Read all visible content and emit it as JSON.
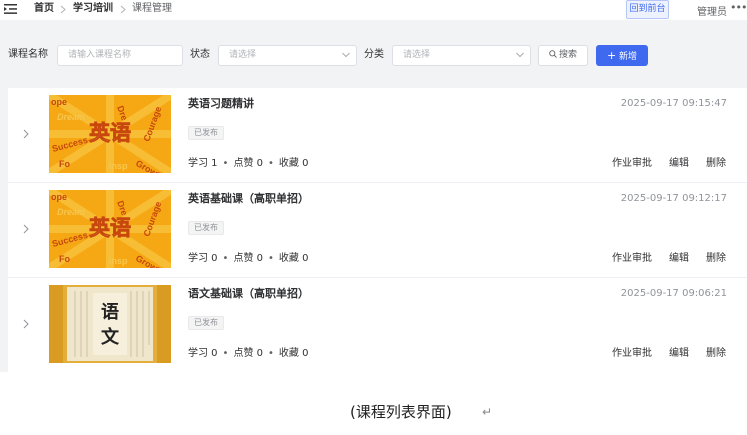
{
  "topbar": {
    "breadcrumb": [
      "首页",
      "学习培训",
      "课程管理"
    ],
    "back_button": "回到前台",
    "user": "管理员",
    "more": "•••"
  },
  "filters": {
    "course_name_label": "课程名称",
    "course_name_placeholder": "请输入课程名称",
    "status_label": "状态",
    "status_placeholder": "请选择",
    "category_label": "分类",
    "category_placeholder": "请选择",
    "search_button": "搜索",
    "add_button": "新增"
  },
  "courses": [
    {
      "title": "英语习题精讲",
      "timestamp": "2025-09-17 09:15:47",
      "status": "已发布",
      "stats": "学习 1",
      "likes": "点赞 0",
      "favorites": "收藏 0",
      "thumb_text": "英语",
      "thumb_words": [
        "Dream",
        "Courage",
        "Success",
        "Growth",
        "Inspire",
        "ope",
        "Dre",
        "Fo",
        "Insp"
      ],
      "actions": [
        "作业审批",
        "编辑",
        "删除"
      ]
    },
    {
      "title": "英语基础课（高职单招）",
      "timestamp": "2025-09-17 09:12:17",
      "status": "已发布",
      "stats": "学习 0",
      "likes": "点赞 0",
      "favorites": "收藏 0",
      "thumb_text": "英语",
      "thumb_words": [
        "Dream",
        "Courage",
        "Success",
        "Growth",
        "Inspire",
        "ope",
        "Dre",
        "Fo",
        "Insp"
      ],
      "actions": [
        "作业审批",
        "编辑",
        "删除"
      ]
    },
    {
      "title": "语文基础课（高职单招）",
      "timestamp": "2025-09-17 09:06:21",
      "status": "已发布",
      "stats": "学习 0",
      "likes": "点赞 0",
      "favorites": "收藏 0",
      "thumb_text_top": "语",
      "thumb_text_bottom": "文",
      "actions": [
        "作业审批",
        "编辑",
        "删除"
      ]
    }
  ],
  "caption": "(课程列表界面)",
  "return_mark": "↵",
  "colors": {
    "primary": "#3f6af0",
    "page_bg": "#f2f3f5",
    "thumb_orange": "#f5a814",
    "thumb_paper": "#efe6cc"
  },
  "icons": [
    "menu-fold-icon",
    "chevron-right-icon",
    "chevron-down-icon",
    "search-icon",
    "plus-icon"
  ]
}
